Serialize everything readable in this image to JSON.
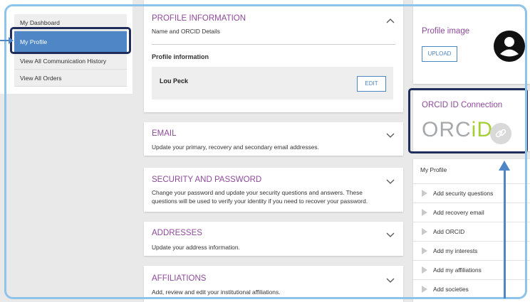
{
  "nav": {
    "items": [
      {
        "label": "My Dashboard"
      },
      {
        "label": "My Profile"
      },
      {
        "label": "View All Communication History"
      },
      {
        "label": "View All Orders"
      }
    ]
  },
  "profile_card": {
    "title": "PROFILE INFORMATION",
    "desc": "Name and ORCID Details",
    "sub_head": "Profile information",
    "name": "Lou Peck",
    "edit_label": "EDIT"
  },
  "email_card": {
    "title": "EMAIL",
    "desc": "Update your primary, recovery and secondary email addresses."
  },
  "security_card": {
    "title": "SECURITY AND PASSWORD",
    "desc_line1": "Change your password and update your security questions and answers. These",
    "desc_line2": "questions will be used to verify your identity if you need to recover your password."
  },
  "addresses_card": {
    "title": "ADDRESSES",
    "desc": "Update your address information."
  },
  "affiliations_card": {
    "title": "AFFILIATIONS",
    "desc": "Add, review and edit your institutional affiliations."
  },
  "profile_image": {
    "title": "Profile image",
    "upload_label": "UPLOAD"
  },
  "orcid": {
    "title": "ORCID ID Connection",
    "logo_prefix": "ORC",
    "logo_suffix": "iD"
  },
  "tasks": {
    "heading": "My Profile",
    "items": [
      {
        "label": "Add security questions"
      },
      {
        "label": "Add recovery email"
      },
      {
        "label": "Add ORCID"
      },
      {
        "label": "Add my interests"
      },
      {
        "label": "Add my affiliations"
      },
      {
        "label": "Add societies"
      }
    ]
  },
  "colors": {
    "accent": "#4f86c6",
    "title": "#8d4a9a",
    "highlight": "#1f2d5a",
    "orcid_green": "#a6ce39"
  }
}
